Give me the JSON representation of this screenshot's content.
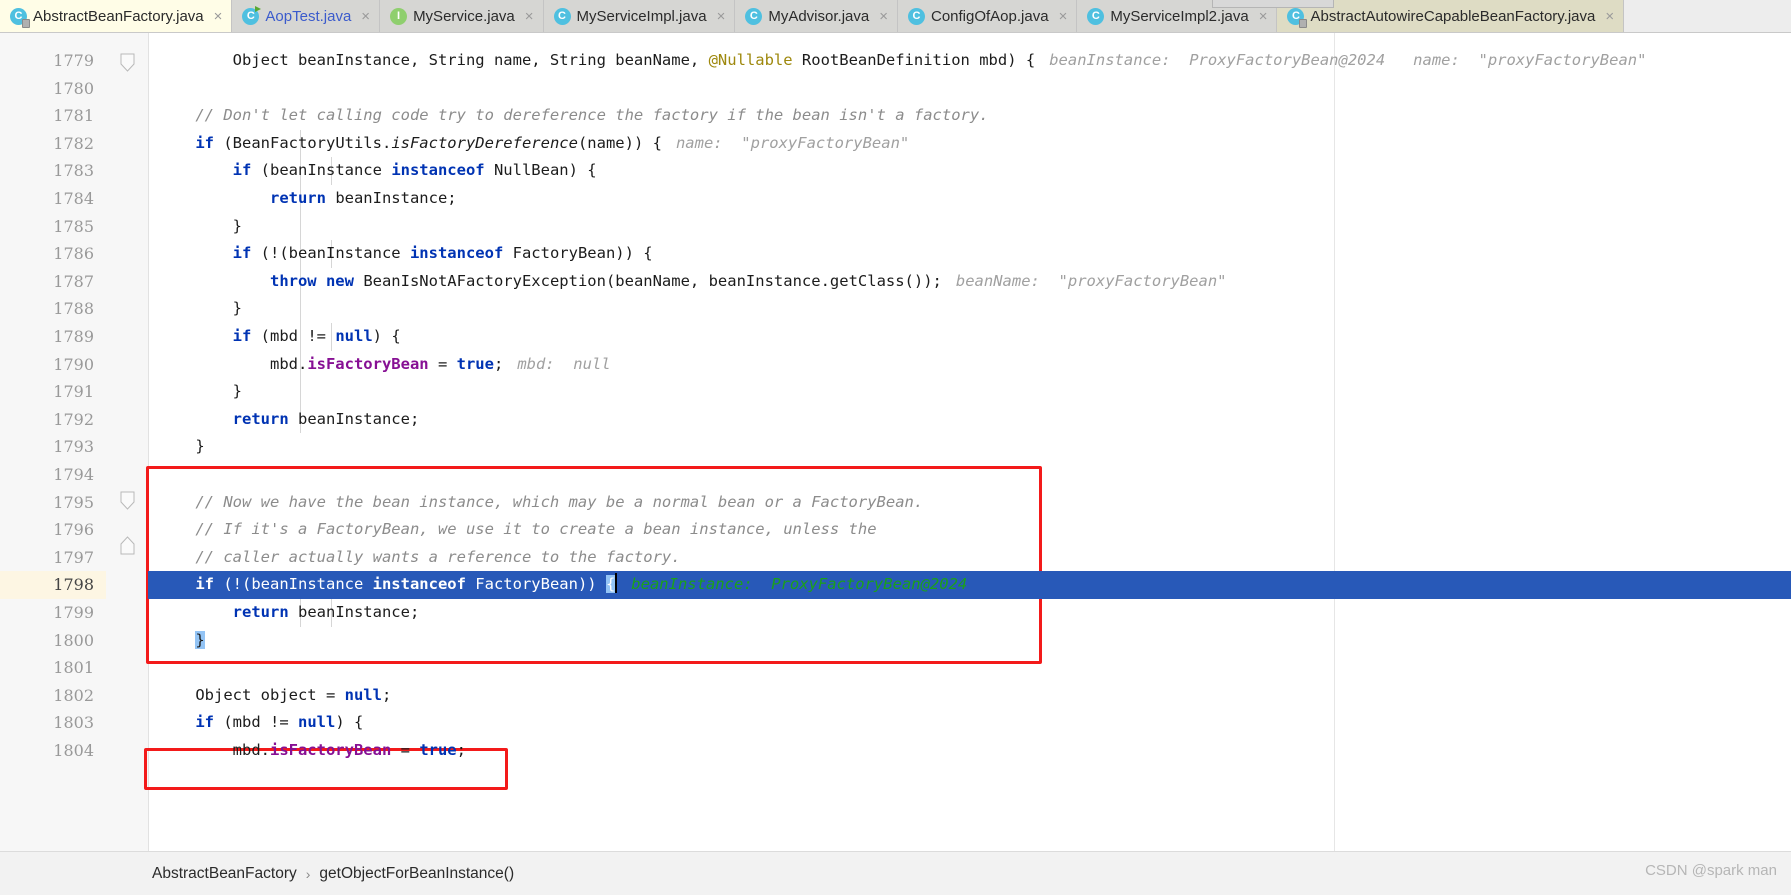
{
  "window": {
    "app": "IntelliJ IDEA Editor",
    "watermark": "CSDN @spark man"
  },
  "tabs": [
    {
      "label": "AbstractBeanFactory.java",
      "icon": "java-class-icon",
      "state": "active",
      "close": "×"
    },
    {
      "label": "AopTest.java",
      "icon": "java-test-class-icon",
      "state": "inactive",
      "close": "×"
    },
    {
      "label": "MyService.java",
      "icon": "java-interface-icon",
      "state": "inactive",
      "close": "×"
    },
    {
      "label": "MyServiceImpl.java",
      "icon": "java-class-icon",
      "state": "inactive",
      "close": "×"
    },
    {
      "label": "MyAdvisor.java",
      "icon": "java-class-icon",
      "state": "inactive",
      "close": "×"
    },
    {
      "label": "ConfigOfAop.java",
      "icon": "java-class-icon",
      "state": "inactive",
      "close": "×"
    },
    {
      "label": "MyServiceImpl2.java",
      "icon": "java-class-icon",
      "state": "inactive",
      "close": "×"
    },
    {
      "label": "AbstractAutowireCapableBeanFactory.java",
      "icon": "java-class-icon",
      "state": "inactive",
      "close": "×"
    }
  ],
  "editor": {
    "first_line_number": 1779,
    "caret_line_number": 1798,
    "lines": [
      {
        "n": 1779,
        "text": "        Object beanInstance, String name, String beanName, @Nullable RootBeanDefinition mbd) {"
      },
      {
        "n": 1780,
        "text": ""
      },
      {
        "n": 1781,
        "text": "    // Don't let calling code try to dereference the factory if the bean isn't a factory."
      },
      {
        "n": 1782,
        "text": "    if (BeanFactoryUtils.isFactoryDereference(name)) {"
      },
      {
        "n": 1783,
        "text": "        if (beanInstance instanceof NullBean) {"
      },
      {
        "n": 1784,
        "text": "            return beanInstance;"
      },
      {
        "n": 1785,
        "text": "        }"
      },
      {
        "n": 1786,
        "text": "        if (!(beanInstance instanceof FactoryBean)) {"
      },
      {
        "n": 1787,
        "text": "            throw new BeanIsNotAFactoryException(beanName, beanInstance.getClass());"
      },
      {
        "n": 1788,
        "text": "        }"
      },
      {
        "n": 1789,
        "text": "        if (mbd != null) {"
      },
      {
        "n": 1790,
        "text": "            mbd.isFactoryBean = true;"
      },
      {
        "n": 1791,
        "text": "        }"
      },
      {
        "n": 1792,
        "text": "        return beanInstance;"
      },
      {
        "n": 1793,
        "text": "    }"
      },
      {
        "n": 1794,
        "text": ""
      },
      {
        "n": 1795,
        "text": "    // Now we have the bean instance, which may be a normal bean or a FactoryBean."
      },
      {
        "n": 1796,
        "text": "    // If it's a FactoryBean, we use it to create a bean instance, unless the"
      },
      {
        "n": 1797,
        "text": "    // caller actually wants a reference to the factory."
      },
      {
        "n": 1798,
        "text": "    if (!(beanInstance instanceof FactoryBean)) {"
      },
      {
        "n": 1799,
        "text": "        return beanInstance;"
      },
      {
        "n": 1800,
        "text": "    }"
      },
      {
        "n": 1801,
        "text": ""
      },
      {
        "n": 1802,
        "text": "    Object object = null;"
      },
      {
        "n": 1803,
        "text": "    if (mbd != null) {"
      },
      {
        "n": 1804,
        "text": "        mbd.isFactoryBean = true;"
      }
    ],
    "inlay_hints": [
      {
        "line": 1779,
        "text": "beanInstance:  ProxyFactoryBean@2024   name:  \"proxyFactoryBean\""
      },
      {
        "line": 1782,
        "text": "name:  \"proxyFactoryBean\""
      },
      {
        "line": 1787,
        "text": "beanName:  \"proxyFactoryBean\""
      },
      {
        "line": 1790,
        "text": "mbd:  null"
      },
      {
        "line": 1798,
        "text": "beanInstance:  ProxyFactoryBean@2024"
      }
    ],
    "tokens": {
      "l1779": {
        "t1": "        Object beanInstance, String name, String beanName, ",
        "anno": "@Nullable",
        "t2": " RootBeanDefinition mbd) {"
      },
      "l1781": {
        "cmt": "    // Don't let calling code try to dereference the factory if the bean isn't a factory."
      },
      "l1782": {
        "kw": "if",
        "a": "    ",
        "b": " (BeanFactoryUtils.",
        "m": "isFactoryDereference",
        "c": "(name)) {"
      },
      "l1783": {
        "a": "        ",
        "kw": "if",
        "b": " (beanInstance ",
        "kw2": "instanceof",
        "c": " NullBean) {"
      },
      "l1784": {
        "a": "            ",
        "kw": "return",
        "b": " beanInstance;"
      },
      "l1785": {
        "a": "        }"
      },
      "l1786": {
        "a": "        ",
        "kw": "if",
        "b": " (!(beanInstance ",
        "kw2": "instanceof",
        "c": " FactoryBean)) {"
      },
      "l1787": {
        "a": "            ",
        "kw": "throw new",
        "b": " BeanIsNotAFactoryException(beanName, beanInstance.getClass());"
      },
      "l1788": {
        "a": "        }"
      },
      "l1789": {
        "a": "        ",
        "kw": "if",
        "b": " (mbd != ",
        "kw2": "null",
        "c": ") {"
      },
      "l1790": {
        "a": "            mbd.",
        "fld": "isFactoryBean",
        "b": " = ",
        "kw": "true",
        "c": ";"
      },
      "l1791": {
        "a": "        }"
      },
      "l1792": {
        "a": "        ",
        "kw": "return",
        "b": " beanInstance;"
      },
      "l1793": {
        "a": "    }"
      },
      "l1795": {
        "cmt": "    // Now we have the bean instance, which may be a normal bean or a FactoryBean."
      },
      "l1796": {
        "cmt": "    // If it's a FactoryBean, we use it to create a bean instance, unless the"
      },
      "l1797": {
        "cmt": "    // caller actually wants a reference to the factory."
      },
      "l1798": {
        "a": "    ",
        "kw": "if",
        "b": " (!(beanInstance ",
        "kw2": "instanceof",
        "c": " FactoryBean)) ",
        "brace": "{"
      },
      "l1799": {
        "a": "        ",
        "kw": "return",
        "b": " beanInstance;"
      },
      "l1800": {
        "brace": "}",
        "a": "    "
      },
      "l1802": {
        "a": "    Object object = ",
        "kw": "null",
        "b": ";"
      },
      "l1803": {
        "a": "    ",
        "kw": "if",
        "b": " (mbd != ",
        "kw2": "null",
        "c": ") {"
      },
      "l1804": {
        "a": "        mbd.",
        "fld": "isFactoryBean",
        "b": " = ",
        "kw": "true",
        "c": ";"
      }
    }
  },
  "breadcrumb": {
    "class": "AbstractBeanFactory",
    "separator": "›",
    "method": "getObjectForBeanInstance()"
  },
  "colors": {
    "keyword": "#0033b3",
    "field": "#871094",
    "comment": "#8c8c8c",
    "hint": "#a0a0a0",
    "hint_green": "#1ba01b",
    "selection": "#2859b8",
    "annotation_box": "#f31a1a",
    "tab_active_bg": "#fffde7"
  }
}
